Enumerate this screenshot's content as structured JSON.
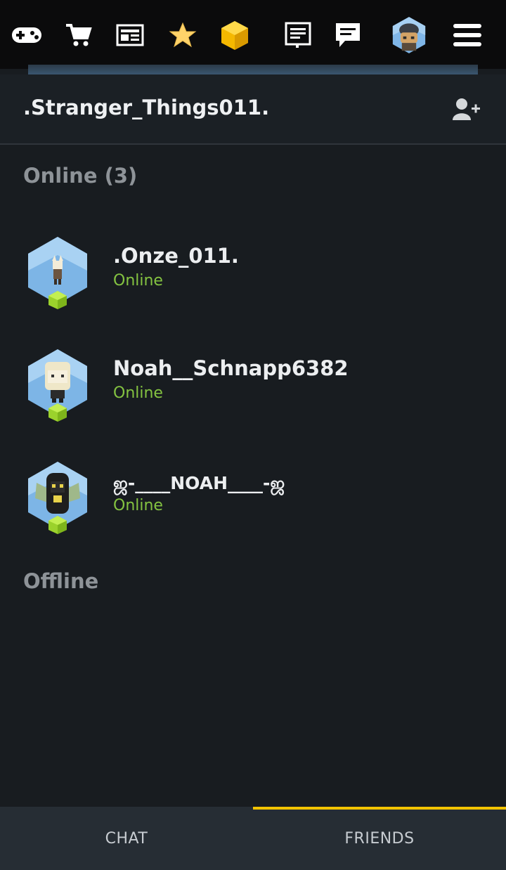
{
  "nav": {
    "icons": [
      "gamepad-icon",
      "cart-icon",
      "news-icon",
      "star-icon",
      "cube-icon",
      "notes-icon",
      "chat-icon",
      "profile-avatar",
      "menu-icon"
    ],
    "colors": {
      "star": "#ffd36a",
      "cube": "#f5b800"
    }
  },
  "header": {
    "title": ".Stranger_Things011."
  },
  "sections": {
    "online": "Online (3)",
    "offline": "Offline"
  },
  "friends": [
    {
      "name": ".Onze_011.",
      "status": "Online"
    },
    {
      "name": "Noah__Schnapp6382",
      "status": "Online"
    },
    {
      "name": "ஜ-____NOAH____-ஜ",
      "status": "Online"
    }
  ],
  "tabs": [
    {
      "label": "CHAT",
      "active": false
    },
    {
      "label": "FRIENDS",
      "active": true
    }
  ],
  "colors": {
    "accent": "#f2c300",
    "online": "#84c341",
    "background": "#181c20"
  }
}
